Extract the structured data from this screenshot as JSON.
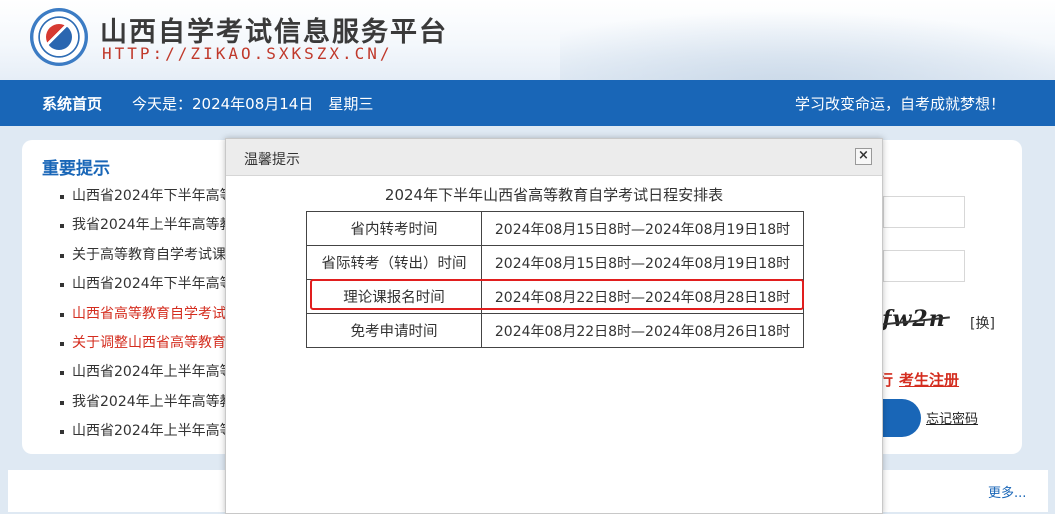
{
  "header": {
    "site_title": "山西自学考试信息服务平台",
    "site_url": "HTTP://ZIKAO.SXKSZX.CN/"
  },
  "nav": {
    "home_label": "系统首页",
    "date_text": "今天是：2024年08月14日　星期三",
    "slogan": "学习改变命运，自考成就梦想！"
  },
  "notices": {
    "heading": "重要提示",
    "items": [
      "山西省2024年下半年高等",
      "我省2024年上半年高等教",
      "关于高等教育自学考试课",
      "山西省2024年下半年高等",
      "山西省高等教育自学考试",
      "关于调整山西省高等教育",
      "山西省2024年上半年高等",
      "我省2024年上半年高等教",
      "山西省2024年上半年高等"
    ],
    "more_label": "更多..."
  },
  "login": {
    "captcha_text": "fw2n",
    "captcha_change_label": "[换]",
    "register_prefix": "行",
    "register_label": "考生注册",
    "forgot_label": "忘记密码"
  },
  "modal": {
    "title": "温馨提示",
    "close_label": "×",
    "caption": "2024年下半年山西省高等教育自学考试日程安排表",
    "rows": [
      {
        "label": "省内转考时间",
        "time": "2024年08月15日8时—2024年08月19日18时"
      },
      {
        "label": "省际转考（转出）时间",
        "time": "2024年08月15日8时—2024年08月19日18时"
      },
      {
        "label": "理论课报名时间",
        "time": "2024年08月22日8时—2024年08月28日18时"
      },
      {
        "label": "免考申请时间",
        "time": "2024年08月22日8时—2024年08月26日18时"
      }
    ],
    "highlighted_row": "理论课报名时间"
  },
  "colors": {
    "nav_blue": "#1966b7",
    "alert_red": "#d42d1f",
    "highlight_red": "#e11e1e"
  }
}
